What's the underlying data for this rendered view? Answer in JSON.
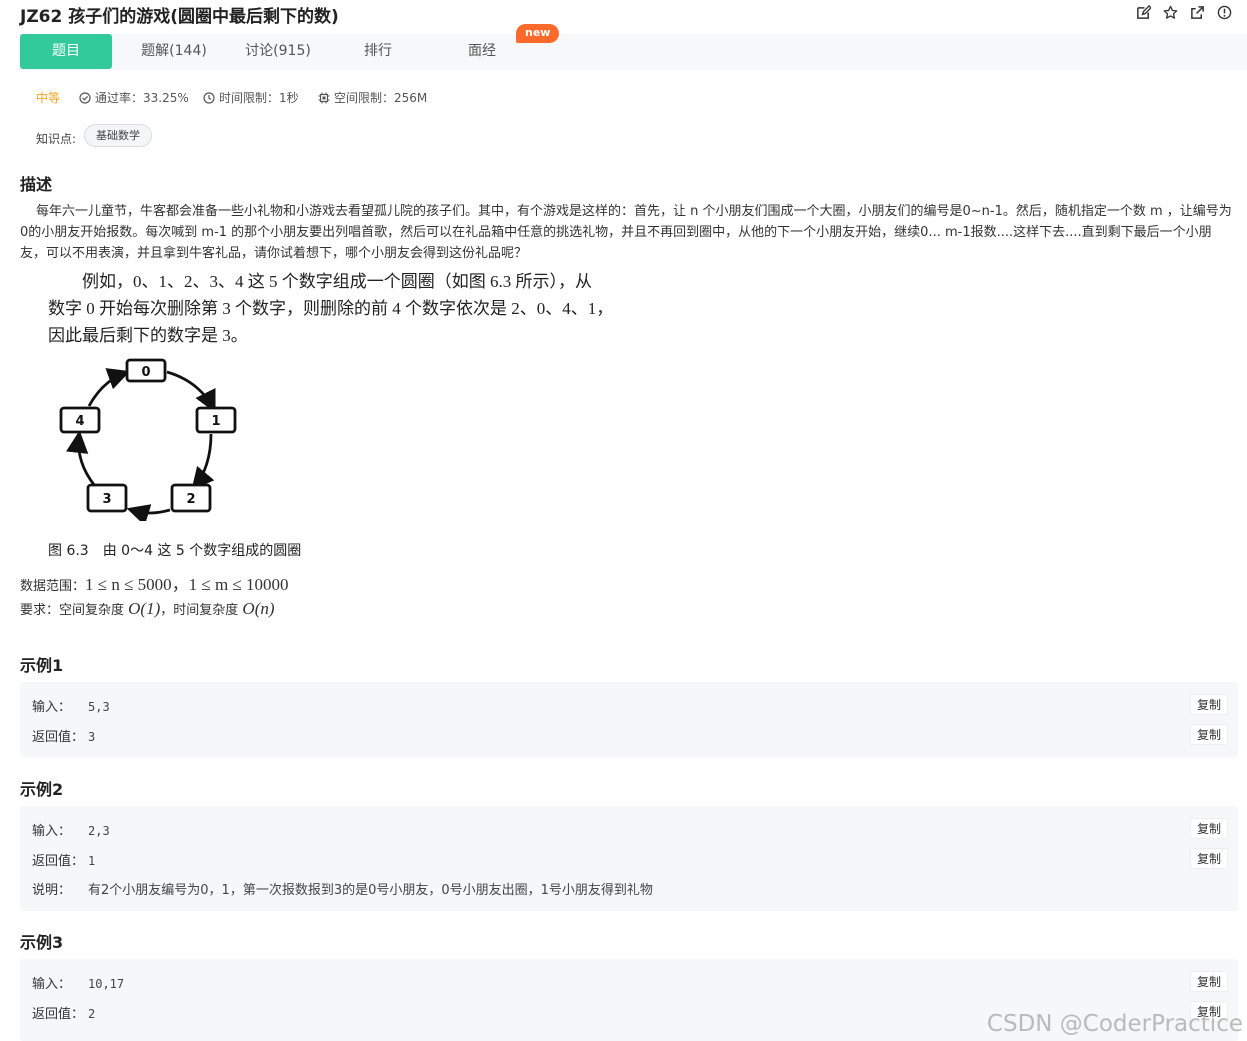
{
  "header": {
    "title": "JZ62  孩子们的游戏(圆圈中最后剩下的数)",
    "icons": [
      "edit-icon",
      "star-icon",
      "share-icon",
      "info-icon"
    ]
  },
  "tabs": [
    {
      "label": "题目",
      "active": true
    },
    {
      "label": "题解(144)"
    },
    {
      "label": "讨论(915)"
    },
    {
      "label": "排行"
    },
    {
      "label": "面经"
    }
  ],
  "new_badge": "new",
  "meta": {
    "difficulty": "中等",
    "pass_rate": "通过率：33.25%",
    "time_limit": "时间限制：1秒",
    "space_limit": "空间限制：256M"
  },
  "knowledge": {
    "label": "知识点:",
    "tag": "基础数学"
  },
  "description": {
    "heading": "描述",
    "text": "每年六一儿童节，牛客都会准备一些小礼物和小游戏去看望孤儿院的孩子们。其中，有个游戏是这样的：首先，让 n 个小朋友们围成一个大圈，小朋友们的编号是0~n-1。然后，随机指定一个数 m ，让编号为0的小朋友开始报数。每次喊到 m-1 的那个小朋友要出列唱首歌，然后可以在礼品箱中任意的挑选礼物，并且不再回到圈中，从他的下一个小朋友开始，继续0... m-1报数....这样下去....直到剩下最后一个小朋友，可以不用表演，并且拿到牛客礼品，请你试着想下，哪个小朋友会得到这份礼品呢？",
    "book_lines": [
      "例如，0、1、2、3、4 这 5 个数字组成一个圆圈（如图 6.3 所示），从",
      "数字 0 开始每次删除第 3 个数字，则删除的前 4 个数字依次是 2、0、4、1，",
      "因此最后剩下的数字是 3。"
    ],
    "figure_nodes": [
      "0",
      "1",
      "2",
      "3",
      "4"
    ],
    "figure_caption": "图 6.3　由 0～4 这 5 个数字组成的圆圈",
    "range_label": "数据范围：",
    "range_math": "1 ≤ n ≤ 5000，1 ≤ m ≤ 10000",
    "require_label": "要求：空间复杂度",
    "require_space": "O(1)",
    "require_mid": "，时间复杂度",
    "require_time": "O(n)"
  },
  "examples": [
    {
      "title": "示例1",
      "input_label": "输入：",
      "input": "5,3",
      "output_label": "返回值：",
      "output": "3"
    },
    {
      "title": "示例2",
      "input_label": "输入：",
      "input": "2,3",
      "output_label": "返回值：",
      "output": "1",
      "note_label": "说明：",
      "note": "有2个小朋友编号为0，1，第一次报数报到3的是0号小朋友，0号小朋友出圈，1号小朋友得到礼物"
    },
    {
      "title": "示例3",
      "input_label": "输入：",
      "input": "10,17",
      "output_label": "返回值：",
      "output": "2"
    }
  ],
  "copy_label": "复制",
  "watermark": "CSDN @CoderPractice"
}
